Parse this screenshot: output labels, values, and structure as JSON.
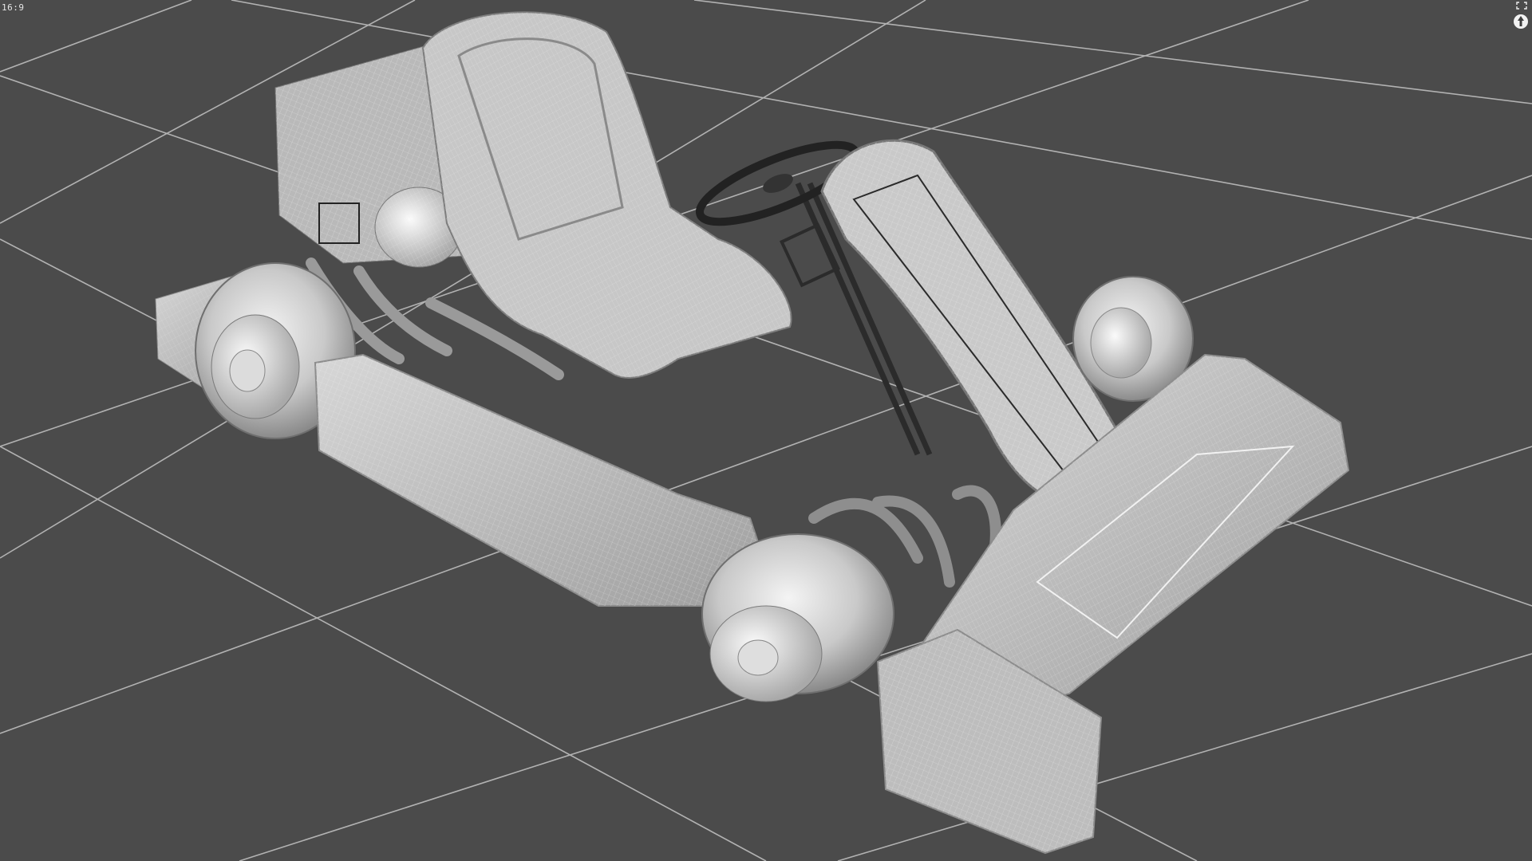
{
  "viewport": {
    "aspect_label": "16:9",
    "shading_mode": "wireframe-on-shaded",
    "grid_visible": true,
    "background_color": "#4b4b4b",
    "grid_color": "#bdbdbd"
  },
  "corner_tools": {
    "maximize_icon": "maximize-corners-icon",
    "navigate_icon": "navigation-gizmo-icon"
  },
  "model": {
    "type": "go-kart",
    "parts": [
      "engine",
      "seat",
      "steering-wheel",
      "steering-column",
      "front-fairing",
      "left-side-pod",
      "right-side-pod",
      "rear-left-wheel",
      "front-left-wheel",
      "front-right-wheel",
      "rear-bumper"
    ]
  }
}
